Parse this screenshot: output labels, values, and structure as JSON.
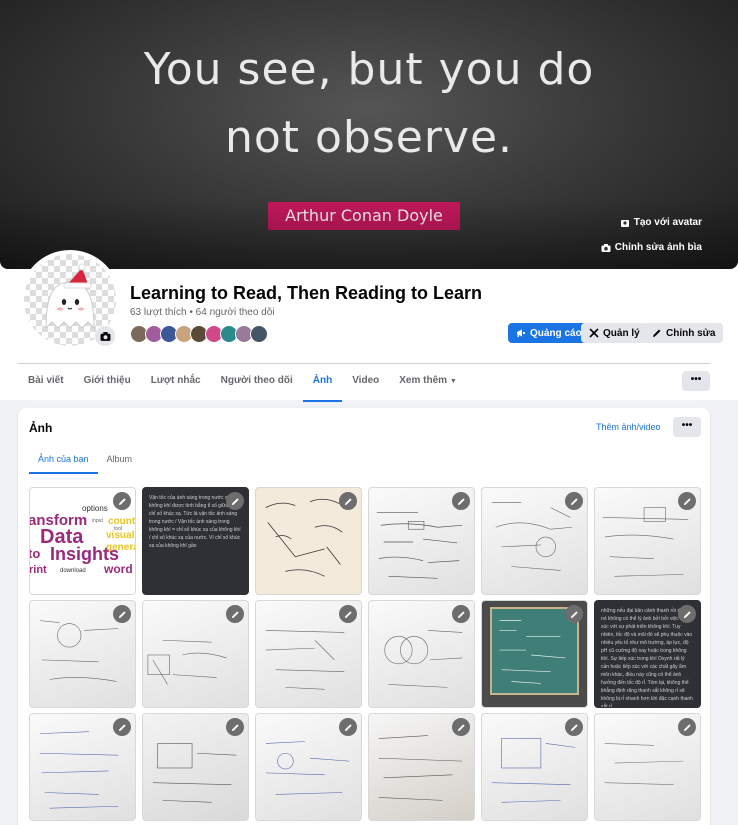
{
  "cover": {
    "quote_line1": "You see, but you do",
    "quote_line2": "not observe.",
    "author": "Arthur Conan Doyle",
    "create_avatar_label": "Tạo với avatar",
    "edit_cover_label": "Chỉnh sửa ảnh bìa"
  },
  "page": {
    "title": "Learning to Read, Then Reading to Learn",
    "stats": "63 lượt thích • 64 người theo dõi",
    "friend_avatar_colors": [
      "#7b6a5a",
      "#a05c9c",
      "#3b5998",
      "#c9a27e",
      "#5a4a3a",
      "#d04a8a",
      "#2b8a8a",
      "#9a7a9a",
      "#445566"
    ]
  },
  "actions": {
    "ads_label": "Quảng cáo",
    "manage_label": "Quản lý",
    "edit_label": "Chỉnh sửa"
  },
  "tabs": [
    {
      "label": "Bài viết"
    },
    {
      "label": "Giới thiệu"
    },
    {
      "label": "Lượt nhắc"
    },
    {
      "label": "Người theo dõi"
    },
    {
      "label": "Ảnh"
    },
    {
      "label": "Video"
    },
    {
      "label": "Xem thêm"
    }
  ],
  "tabs_more_icon": "dots-icon",
  "photos_card": {
    "title": "Ảnh",
    "add_link": "Thêm ảnh/video",
    "subtabs": [
      {
        "label": "Ảnh của bạn"
      },
      {
        "label": "Album"
      }
    ]
  },
  "photo_texts": {
    "wordcloud": [
      "options",
      "ansform",
      "Data",
      "count",
      "visualiz",
      "generat",
      "Insights",
      "to",
      "rint",
      "download",
      "word",
      "input",
      "tool"
    ],
    "dark1": "Vận tốc của ánh sáng trong nước so với không khí được tính bằng tỉ số giữa hai chỉ số khúc xạ. Tức là vận tốc ánh sáng trong nước / Vận tốc ánh sáng trong không khí = chỉ số khúc xạ của không khí / chỉ số khúc xạ của nước. Vì chỉ số khúc xạ của không khí gần",
    "dark2": "những nếu đại bản cảnh thanh rồi rì thì nó không có thể lý ảnh bởi bởi việc tiếp xúc với sự phát triển không khí. Tuy nhiên, tốc độ và môi đó sẽ phụ thuộc vào nhiều yếu tố như mô trường, áp lực, độ pH cũ cường độ nay hoặc trong không khí. Sự tiếp xúc trong khí Oxynh rất lý cần hoặc tiếp xúc với các chất gây ẩm môn khác, điều này cũng có thể ảnh hưởng đến tốc độ rỉ. Tóm lại, không thể khẳng định răng thanh sắt không rỉ sẽ không bị rỉ nhanh hơn khi đặc cạnh thanh sắt rỉ."
  }
}
